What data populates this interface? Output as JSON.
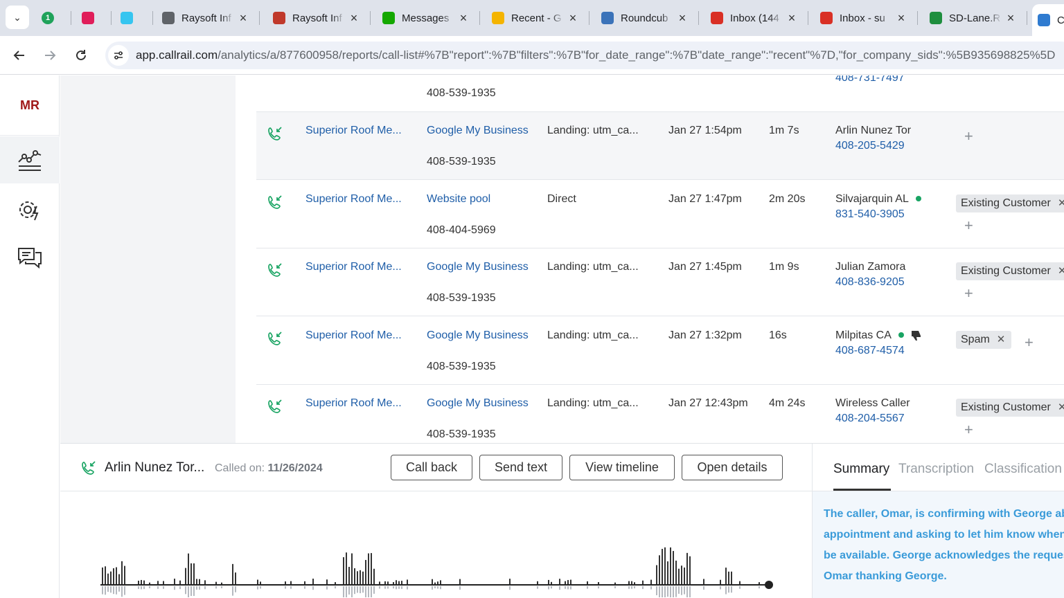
{
  "browser": {
    "tabs": [
      {
        "title": "",
        "favicon": "green-circle-1",
        "color": "#1fa25a"
      },
      {
        "title": "",
        "favicon": "slack-icon",
        "color": "#e01e5a"
      },
      {
        "title": "",
        "favicon": "slack-icon",
        "color": "#36c5f0"
      },
      {
        "title": "Raysoft Inf",
        "favicon": "globe-icon",
        "color": "#5f6368"
      },
      {
        "title": "Raysoft Inf",
        "favicon": "raysoft-icon",
        "color": "#c0392b"
      },
      {
        "title": "Messages",
        "favicon": "upwork-icon",
        "color": "#14a800"
      },
      {
        "title": "Recent - G",
        "favicon": "google-drive-icon",
        "color": "#f4b400"
      },
      {
        "title": "Roundcub",
        "favicon": "roundcube-icon",
        "color": "#3b73b9"
      },
      {
        "title": "Inbox (144",
        "favicon": "gmail-icon",
        "color": "#d93025"
      },
      {
        "title": "Inbox - su",
        "favicon": "gmail-icon",
        "color": "#d93025"
      },
      {
        "title": "SD-Lane.R",
        "favicon": "sheets-icon",
        "color": "#1e8e3e"
      },
      {
        "title": "C",
        "favicon": "callrail-icon",
        "color": "#2f7bd0"
      }
    ],
    "url_host": "app.callrail.com",
    "url_path": "/analytics/a/877600958/reports/call-list#%7B\"report\":%7B\"filters\":%7B\"for_date_range\":%7B\"date_range\":\"recent\"%7D,\"for_company_sids\":%5B935698825%5D"
  },
  "sidebar": {
    "initials": "MR",
    "items": [
      "analytics-icon",
      "settings-automation-icon",
      "chat-icon"
    ]
  },
  "calls": {
    "top_partial": {
      "number": "408-539-1935",
      "caller_phone": "408-731-7497"
    },
    "rows": [
      {
        "company": "Superior Roof Me...",
        "source": "Google My Business",
        "number": "408-539-1935",
        "landing": "Landing: utm_ca...",
        "date": "Jan 27 1:54pm",
        "duration": "1m 7s",
        "caller": "Arlin Nunez Tor",
        "phone": "408-205-5429",
        "tags": [],
        "online": false
      },
      {
        "company": "Superior Roof Me...",
        "source": "Website pool",
        "number": "408-404-5969",
        "landing": "Direct",
        "date": "Jan 27 1:47pm",
        "duration": "2m 20s",
        "caller": "Silvajarquin AL",
        "phone": "831-540-3905",
        "tags": [
          "Existing Customer"
        ],
        "online": true
      },
      {
        "company": "Superior Roof Me...",
        "source": "Google My Business",
        "number": "408-539-1935",
        "landing": "Landing: utm_ca...",
        "date": "Jan 27 1:45pm",
        "duration": "1m 9s",
        "caller": "Julian Zamora",
        "phone": "408-836-9205",
        "tags": [
          "Existing Customer"
        ],
        "online": false
      },
      {
        "company": "Superior Roof Me...",
        "source": "Google My Business",
        "number": "408-539-1935",
        "landing": "Landing: utm_ca...",
        "date": "Jan 27 1:32pm",
        "duration": "16s",
        "caller": "Milpitas CA",
        "phone": "408-687-4574",
        "tags": [
          "Spam"
        ],
        "online": true
      },
      {
        "company": "Superior Roof Me...",
        "source": "Google My Business",
        "number": "408-539-1935",
        "landing": "Landing: utm_ca...",
        "date": "Jan 27 12:43pm",
        "duration": "4m 24s",
        "caller": "Wireless Caller",
        "phone": "408-204-5567",
        "tags": [
          "Existing Customer"
        ],
        "online": false
      }
    ]
  },
  "detail": {
    "caller_name": "Arlin Nunez Tor...",
    "called_on_label": "Called on:",
    "called_on_date": "11/26/2024",
    "buttons": [
      "Call back",
      "Send text",
      "View timeline",
      "Open details"
    ],
    "tabs": [
      "Summary",
      "Transcription",
      "Classification"
    ],
    "summary_text": "The caller, Omar, is confirming with George about the appointment and asking to let him know when they will be available. George acknowledges the request, with Omar thanking George."
  },
  "colors": {
    "accent": "#1f5ea8",
    "green": "#19a463",
    "summary_text": "#3a9bd9"
  }
}
